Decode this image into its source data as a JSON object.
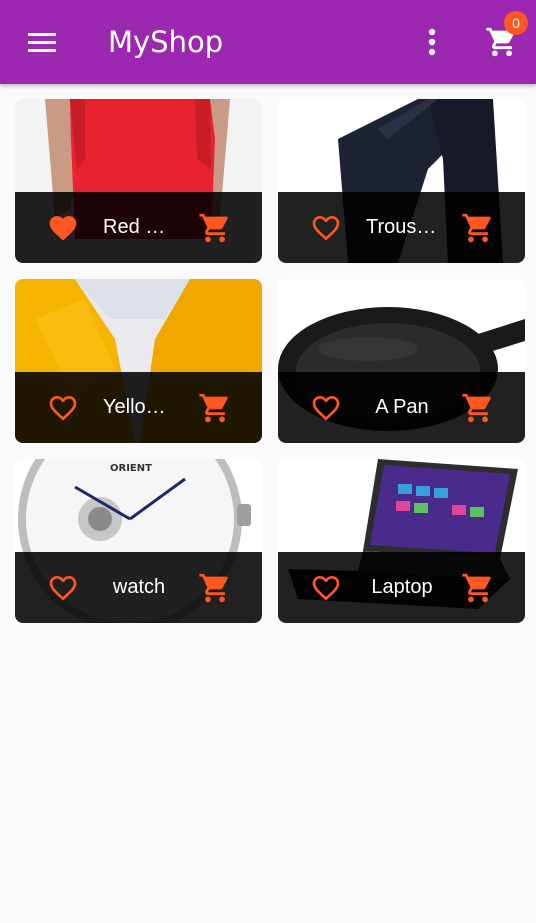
{
  "appbar": {
    "title": "MyShop",
    "cart_count": "0"
  },
  "colors": {
    "primary": "#9c27b0",
    "accent": "#ff5722",
    "background": "#fafafa"
  },
  "products": [
    {
      "title": "Red Shirt",
      "favorite": true,
      "image": "red-shirt"
    },
    {
      "title": "Trousers",
      "favorite": false,
      "image": "trousers"
    },
    {
      "title": "Yellow Scarf",
      "favorite": false,
      "image": "yellow-scarf"
    },
    {
      "title": "A Pan",
      "favorite": false,
      "image": "pan"
    },
    {
      "title": "watch",
      "favorite": false,
      "image": "watch"
    },
    {
      "title": "Laptop",
      "favorite": false,
      "image": "laptop"
    }
  ]
}
